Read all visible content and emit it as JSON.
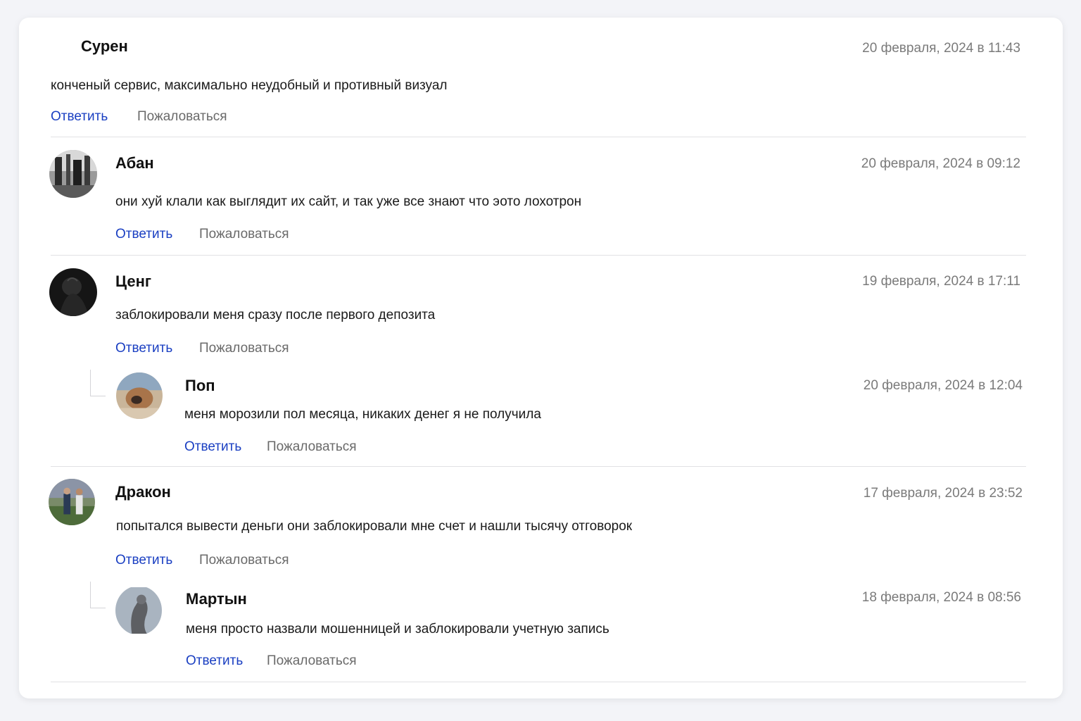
{
  "actions": {
    "reply_label": "Ответить",
    "report_label": "Пожаловаться"
  },
  "colors": {
    "reply_link": "#1a3fc2",
    "report_link": "#6a6a6a",
    "date_text": "#7a7a7a"
  },
  "comments": [
    {
      "author": "Сурен",
      "date": "20 февраля, 2024 в 11:43",
      "text": "конченый сервис, максимально неудобный и противный визуал"
    },
    {
      "author": "Абан",
      "date": "20 февраля, 2024 в 09:12",
      "text": "они хуй клали как выглядит их сайт, и так уже все знают что эото лохотрон"
    },
    {
      "author": "Ценг",
      "date": "19 февраля, 2024 в 17:11",
      "text": "заблокировали меня сразу после первого депозита",
      "replies": [
        {
          "author": "Поп",
          "date": "20 февраля, 2024 в 12:04",
          "text": "меня морозили пол месяца, никаких денег я не получила"
        }
      ]
    },
    {
      "author": "Дракон",
      "date": "17 февраля, 2024 в 23:52",
      "text": "попытался вывести деньги они заблокировали мне счет и нашли тысячу отговорок",
      "replies": [
        {
          "author": "Мартын",
          "date": "18 февраля, 2024 в 08:56",
          "text": "меня просто назвали мошенницей и заблокировали учетную запись"
        }
      ]
    }
  ]
}
